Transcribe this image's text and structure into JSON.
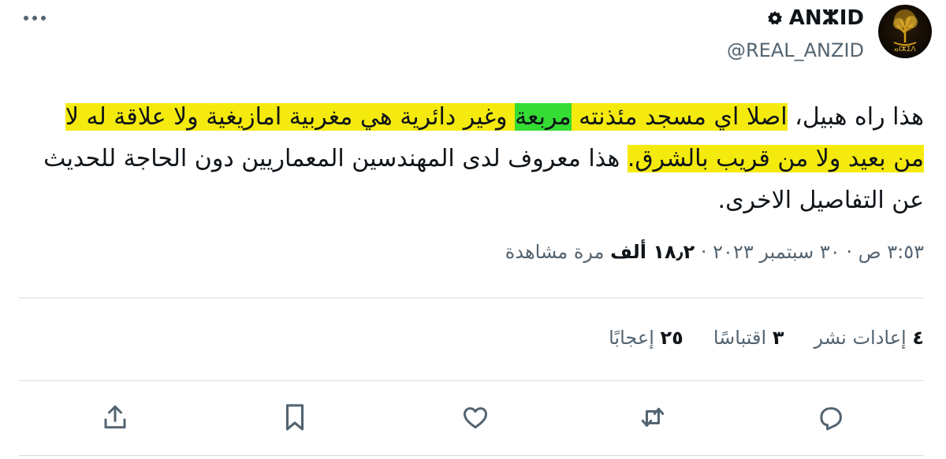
{
  "tweet": {
    "author": {
      "display_name": "ANⵣID",
      "handle": "@REAL_ANZID",
      "avatar_text": "ⴰⵏⵣⵉⴷ"
    },
    "text": {
      "p1": "هذا راه هبيل، ",
      "h1": "اصلا اي مسجد مئذنته ",
      "h2": "مربعة",
      "h3": " وغير دائرية هي مغربية امازيغية ولا علاقة له لا من بعيد ولا من قريب بالشرق.",
      "p2": " هذا معروف لدى المهندسين المعماريين دون الحاجة للحديث عن التفاصيل الاخرى."
    },
    "meta": {
      "time_date": "٣:٥٣ ص · ٣٠ سبتمبر ٢٠٢٣ · ",
      "views_count": "١٨٫٢ ألف",
      "views_label": " مرة مشاهدة"
    },
    "stats": {
      "retweets_count": "٤",
      "retweets_label": "إعادات نشر",
      "quotes_count": "٣",
      "quotes_label": "اقتباسًا",
      "likes_count": "٢٥",
      "likes_label": "إعجابًا"
    },
    "icons": [
      "more-icon",
      "verified-badge-icon",
      "reply-icon",
      "retweet-icon",
      "like-icon",
      "bookmark-icon",
      "share-icon"
    ]
  }
}
